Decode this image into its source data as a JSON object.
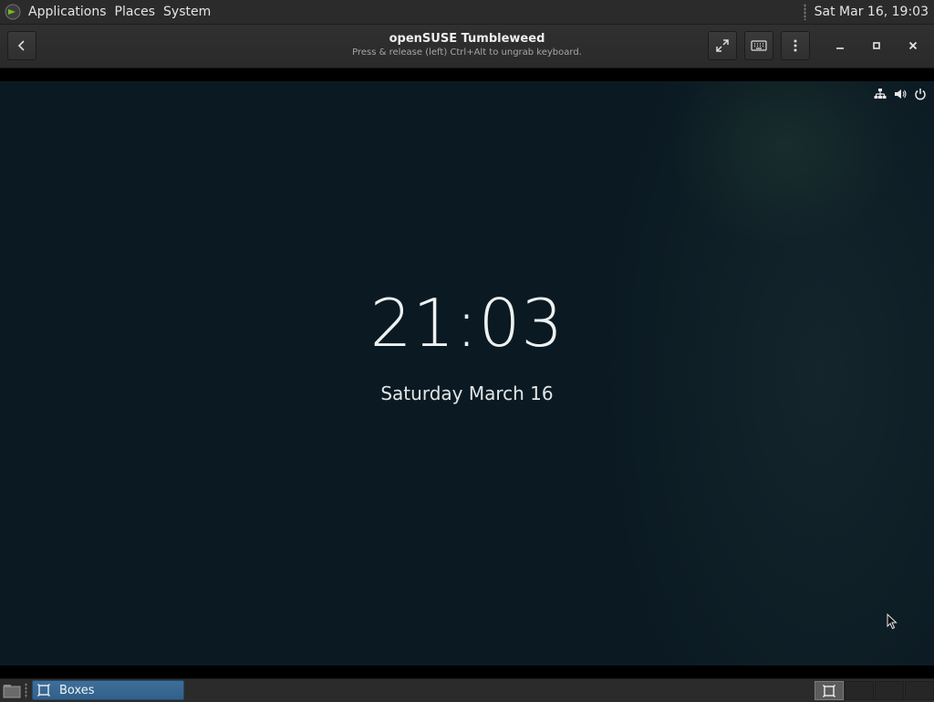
{
  "top_panel": {
    "menu_icon": "opensuse-gecko-icon",
    "menus": [
      "Applications",
      "Places",
      "System"
    ],
    "clock": "Sat Mar 16, 19:03"
  },
  "window": {
    "title": "openSUSE Tumbleweed",
    "subtitle": "Press & release (left) Ctrl+Alt to ungrab keyboard.",
    "buttons": {
      "back": "chevron-left-icon",
      "fullscreen": "fullscreen-icon",
      "keyboard": "keyboard-icon",
      "menu": "vertical-dots-icon",
      "minimize": "minimize-icon",
      "maximize": "maximize-icon",
      "close": "close-icon"
    }
  },
  "vm_screen": {
    "time": "21:03",
    "date": "Saturday March 16",
    "status_icons": [
      "network-icon",
      "volume-icon",
      "power-icon"
    ]
  },
  "taskbar": {
    "task_label": "Boxes",
    "task_icon": "boxes-icon",
    "workspaces": 4,
    "active_workspace": 1
  },
  "colors": {
    "panel": "#2b2b2b",
    "vm_background": "#0b1a22",
    "task_active": "#3a6890",
    "accent_green": "#73ba25"
  }
}
